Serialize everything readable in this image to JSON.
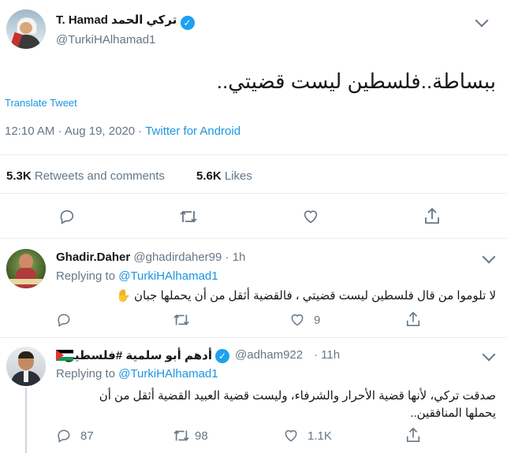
{
  "main": {
    "name_ar": "تركي الحمد",
    "name_en": "T. Hamad",
    "handle": "@TurkiHAlhamad1",
    "text": "ببساطة..فلسطين ليست قضيتي..",
    "translate": "Translate Tweet",
    "time": "12:10 AM · Aug 19, 2020 · ",
    "source": "Twitter for Android",
    "retweets_count": "5.3K",
    "retweets_label": "Retweets and comments",
    "likes_count": "5.6K",
    "likes_label": "Likes"
  },
  "replies": [
    {
      "name": "Ghadir.Daher",
      "handle": "@ghadirdaher99",
      "age": "· 1h",
      "replying_label": "Replying to",
      "replying_handle": "@TurkiHAlhamad1",
      "text": "لا تلوموا من قال فلسطين ليست قضيتي ، فالقضية أثقل من أن يحملها جبان",
      "emoji": "✋",
      "comments": "",
      "retweets": "",
      "likes": "9"
    },
    {
      "name": "أدهم أبو سلمية #فلسطين",
      "handle": "@adham922",
      "age": "· 11h",
      "replying_label": "Replying to",
      "replying_handle": "@TurkiHAlhamad1",
      "text_line1": "صدقت تركي، لأنها قضية الأحرار والشرفاء، وليست قضية العبيد القضية أثقل من أن",
      "text_line2": "يحملها المنافقين..",
      "comments": "87",
      "retweets": "98",
      "likes": "1.1K"
    }
  ],
  "icons": {
    "reply": "reply-icon",
    "retweet": "retweet-icon",
    "like": "heart-icon",
    "share": "share-icon",
    "verified": "verified-icon",
    "chevron": "chevron-down-icon",
    "flag": "palestine-flag-icon"
  },
  "colors": {
    "link": "#1b95e0",
    "muted": "#657786",
    "verified": "#1da1f2",
    "divider": "#e6ecf0"
  }
}
